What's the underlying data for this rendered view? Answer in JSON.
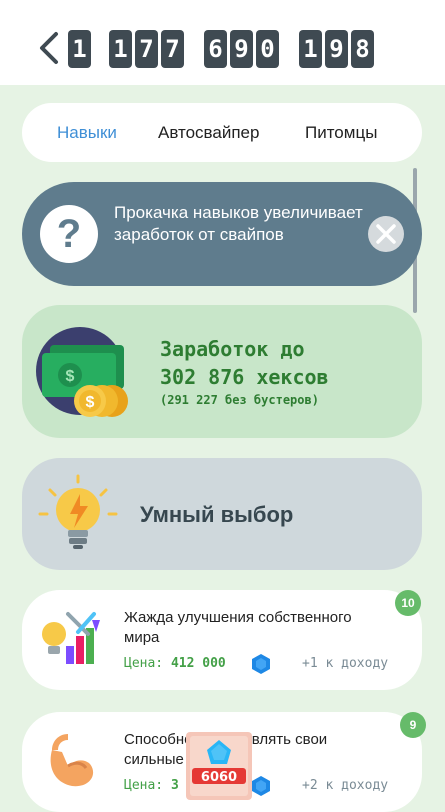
{
  "header": {
    "balance_digits": [
      "1",
      "1",
      "7",
      "7",
      "6",
      "9",
      "0",
      "1",
      "9",
      "8"
    ]
  },
  "tabs": [
    {
      "label": "Навыки",
      "active": true
    },
    {
      "label": "Автосвайпер",
      "active": false
    },
    {
      "label": "Питомцы",
      "active": false
    }
  ],
  "info_banner": {
    "text": "Прокачка навыков увеличивает заработок от свайпов"
  },
  "earnings": {
    "line1": "Заработок до",
    "line2": "302 876 хексов",
    "sub": "(291 227 без бустеров)"
  },
  "smart_choice": {
    "label": "Умный выбор"
  },
  "skills": [
    {
      "title": "Жажда улучшения собственного мира",
      "price_label": "Цена:",
      "price_value": "412 000",
      "bonus": "+1 к доходу",
      "level": "10"
    },
    {
      "title": "Способность проявлять свои сильные стороны",
      "price_label": "Цена:",
      "price_value": "3",
      "bonus": "+2 к доходу",
      "level": "9"
    }
  ],
  "promo_badge": {
    "text": "6060"
  },
  "colors": {
    "background": "#e6f3e4",
    "accent_blue": "#3f8fd6",
    "info_banner": "#5f7c8d",
    "earnings_bg": "#c8e6c9",
    "earnings_text": "#2e7d32",
    "smart_bg": "#cfd8dc",
    "level_badge": "#66bb6a"
  }
}
